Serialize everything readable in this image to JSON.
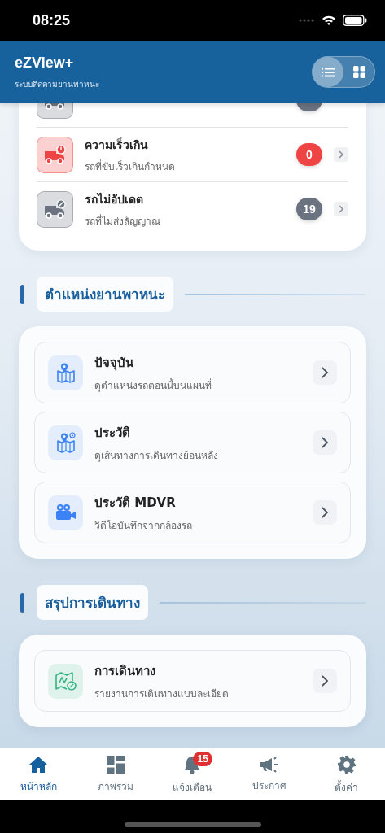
{
  "status_bar": {
    "time": "08:25"
  },
  "header": {
    "title": "eZView+",
    "subtitle": "ระบบติดตามยานพาหนะ",
    "view_modes": [
      {
        "kind": "list",
        "selected": true
      },
      {
        "kind": "grid",
        "selected": false
      }
    ]
  },
  "status_card": {
    "items": [
      {
        "kind": "parked",
        "color": "#6b7280"
      },
      {
        "kind": "speeding",
        "title": "ความเร็วเกิน",
        "subtitle": "รถที่ขับเร็วเกินกำหนด",
        "count": "0",
        "color": "#ef4444"
      },
      {
        "kind": "offline",
        "title": "รถไม่อัปเดต",
        "subtitle": "รถที่ไม่ส่งสัญญาณ",
        "count": "19",
        "color": "#6b7280"
      }
    ]
  },
  "sections": [
    {
      "title": "ตำแหน่งยานพาหนะ",
      "items": [
        {
          "kind": "map-pin",
          "title": "ปัจจุบัน",
          "subtitle": "ดูตำแหน่งรถตอนนี้บนแผนที่"
        },
        {
          "kind": "map-history",
          "title": "ประวัติ",
          "subtitle": "ดูเส้นทางการเดินทางย้อนหลัง"
        },
        {
          "kind": "camera",
          "title": "ประวัติ MDVR",
          "subtitle": "วิดีโอบันทึกจากกล้องรถ"
        }
      ]
    },
    {
      "title": "สรุปการเดินทาง",
      "items": [
        {
          "kind": "route",
          "title": "การเดินทาง",
          "subtitle": "รายงานการเดินทางแบบละเอียด"
        }
      ]
    }
  ],
  "bottom_nav": [
    {
      "kind": "home",
      "label": "หน้าหลัก",
      "selected": true
    },
    {
      "kind": "dashboard",
      "label": "ภาพรวม",
      "selected": false
    },
    {
      "kind": "bell",
      "label": "แจ้งเตือน",
      "selected": false,
      "badge": "15"
    },
    {
      "kind": "megaphone",
      "label": "ประกาศ",
      "selected": false
    },
    {
      "kind": "gear",
      "label": "ตั้งค่า",
      "selected": false
    }
  ]
}
